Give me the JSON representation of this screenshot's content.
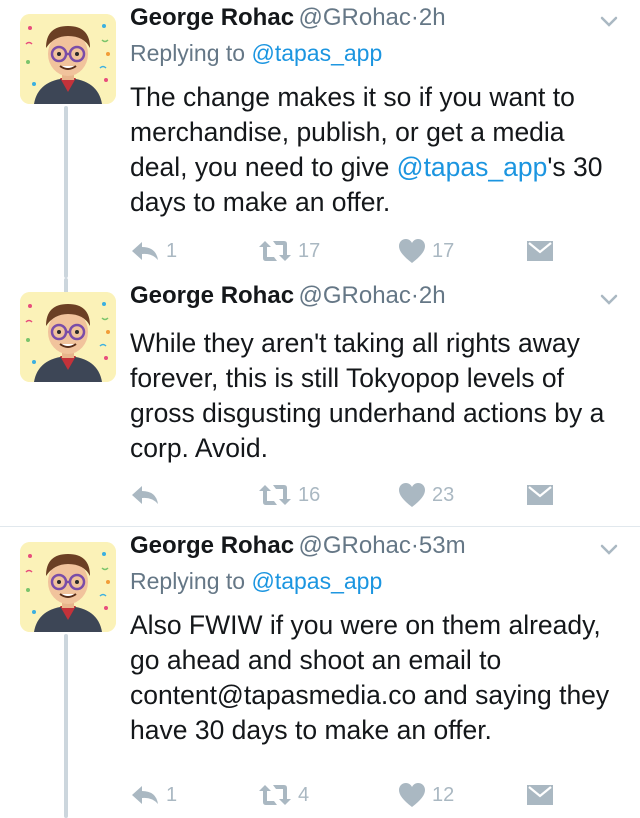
{
  "tweets": [
    {
      "name": "George Rohac",
      "handle": "@GRohac",
      "dot": "·",
      "time": "2h",
      "replying_prefix": "Replying to ",
      "replying_to": "@tapas_app",
      "text_before": "The change makes it so if you want to merchandise, publish, or get a media deal, you need to give ",
      "text_mention": "@tapas_app",
      "text_after": "'s 30 days to make an offer.",
      "reply_count": "1",
      "retweet_count": "17",
      "like_count": "17"
    },
    {
      "name": "George Rohac",
      "handle": "@GRohac",
      "dot": "·",
      "time": "2h",
      "text": "While they aren't taking all rights away forever, this is still Tokyopop levels of gross disgusting underhand actions by a corp. Avoid.",
      "reply_count": "",
      "retweet_count": "16",
      "like_count": "23"
    },
    {
      "name": "George Rohac",
      "handle": "@GRohac",
      "dot": "·",
      "time": "53m",
      "replying_prefix": "Replying to ",
      "replying_to": "@tapas_app",
      "text": "Also FWIW if you were on them already, go ahead and shoot an email to content@tapasmedia.co and saying they have 30 days to make an offer.",
      "reply_count": "1",
      "retweet_count": "4",
      "like_count": "12"
    }
  ],
  "icons": {
    "reply": "reply-icon",
    "retweet": "retweet-icon",
    "like": "heart-icon",
    "dm": "direct-message-icon",
    "more": "chevron-down-icon"
  },
  "colors": {
    "text": "#14171a",
    "secondary": "#657786",
    "link": "#1b95e0",
    "icon": "#aab8c2",
    "thread_line": "#ccd6dd"
  }
}
